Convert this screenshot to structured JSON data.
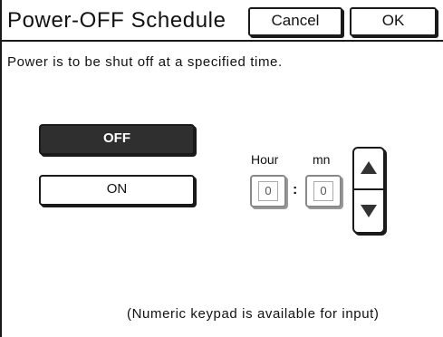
{
  "header": {
    "title": "Power-OFF Schedule",
    "cancel_label": "Cancel",
    "ok_label": "OK"
  },
  "message": "Power is to be shut off at a specified time.",
  "mode": {
    "off_label": "OFF",
    "on_label": "ON",
    "selected": "OFF"
  },
  "time": {
    "hour_label": "Hour",
    "minute_label": "mn",
    "separator": ":",
    "hour_value": "0",
    "minute_value": "0"
  },
  "stepper": {
    "up_icon": "triangle-up-icon",
    "down_icon": "triangle-down-icon"
  },
  "footer_note": "(Numeric keypad is available for input)",
  "colors": {
    "selected_button_bg": "#2f2f2f",
    "border": "#1a1a1a"
  }
}
